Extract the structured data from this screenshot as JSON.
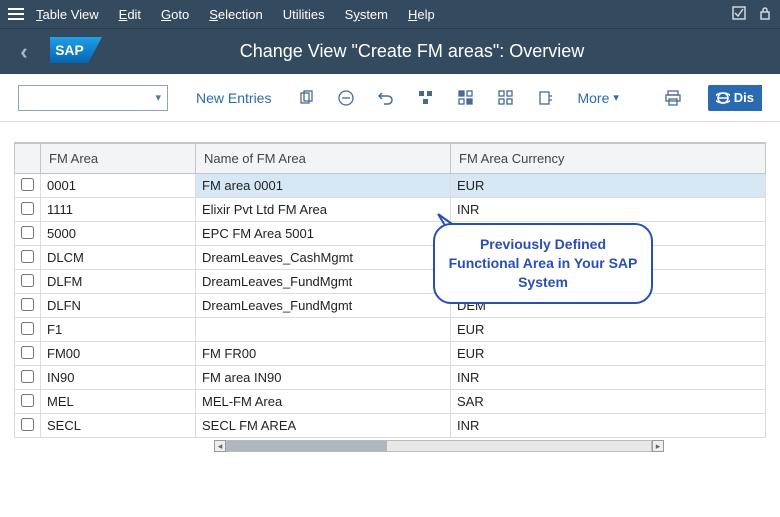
{
  "menubar": {
    "items": [
      {
        "label": "Table View",
        "ul": "T"
      },
      {
        "label": "Edit",
        "ul": "E"
      },
      {
        "label": "Goto",
        "ul": "G"
      },
      {
        "label": "Selection",
        "ul": "S"
      },
      {
        "label": "Utilities",
        "ul": ""
      },
      {
        "label": "System",
        "ul": ""
      },
      {
        "label": "Help",
        "ul": ""
      }
    ]
  },
  "titlebar": {
    "title": "Change View \"Create FM areas\": Overview"
  },
  "toolbar": {
    "new_entries": "New Entries",
    "more": "More",
    "display": "Dis"
  },
  "table": {
    "columns": [
      "FM Area",
      "Name of FM Area",
      "FM Area Currency"
    ],
    "rows": [
      {
        "code": "0001",
        "name": "FM area 0001",
        "curr": "EUR",
        "selected": true
      },
      {
        "code": "1111",
        "name": "Elixir Pvt Ltd FM Area",
        "curr": "INR"
      },
      {
        "code": "5000",
        "name": "EPC FM Area 5001",
        "curr": ""
      },
      {
        "code": "DLCM",
        "name": "DreamLeaves_CashMgmt",
        "curr": ""
      },
      {
        "code": "DLFM",
        "name": "DreamLeaves_FundMgmt",
        "curr": ""
      },
      {
        "code": "DLFN",
        "name": "DreamLeaves_FundMgmt",
        "curr": "DEM"
      },
      {
        "code": "F1",
        "name": "",
        "curr": "EUR"
      },
      {
        "code": "FM00",
        "name": "FM FR00",
        "curr": "EUR"
      },
      {
        "code": "IN90",
        "name": "FM area IN90",
        "curr": "INR"
      },
      {
        "code": "MEL",
        "name": "MEL-FM Area",
        "curr": "SAR"
      },
      {
        "code": "SECL",
        "name": "SECL FM AREA",
        "curr": "INR"
      }
    ]
  },
  "callout": {
    "text": "Previously Defined Functional Area in Your SAP System"
  }
}
